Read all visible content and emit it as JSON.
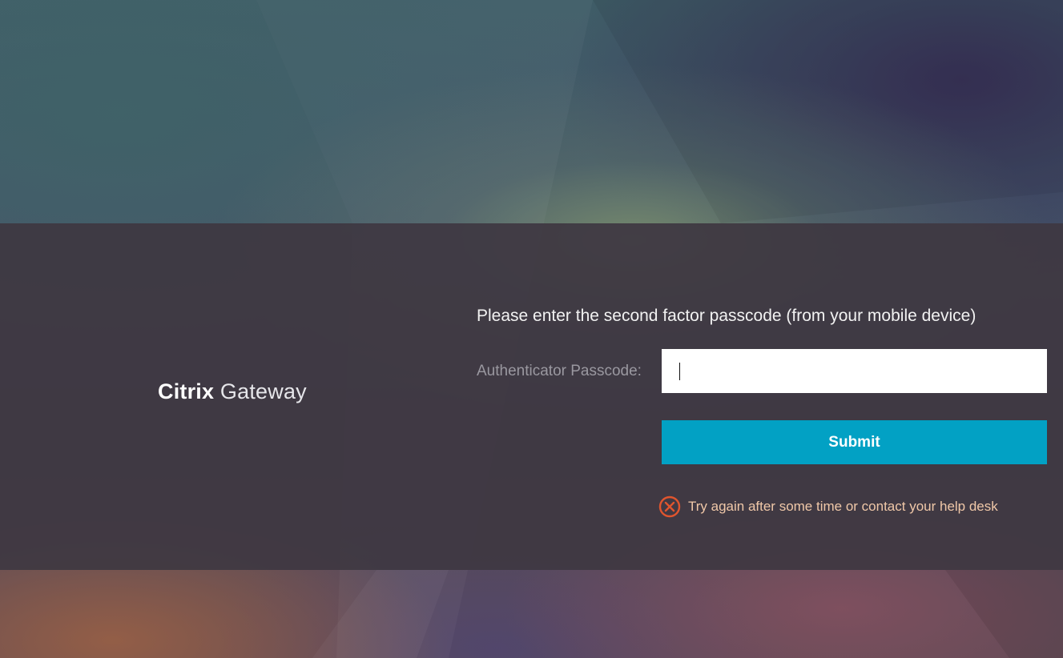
{
  "logo": {
    "brand": "Citrix",
    "product": "Gateway"
  },
  "login": {
    "instruction": "Please enter the second factor passcode (from your mobile device)",
    "passcode_label": "Authenticator Passcode:",
    "passcode_value": "",
    "submit_label": "Submit"
  },
  "error": {
    "icon": "error-circle-x-icon",
    "message": "Try again after some time or contact your help desk",
    "color": "#e0552e"
  },
  "colors": {
    "accent": "#02a1c4",
    "panel": "#3e3842"
  }
}
